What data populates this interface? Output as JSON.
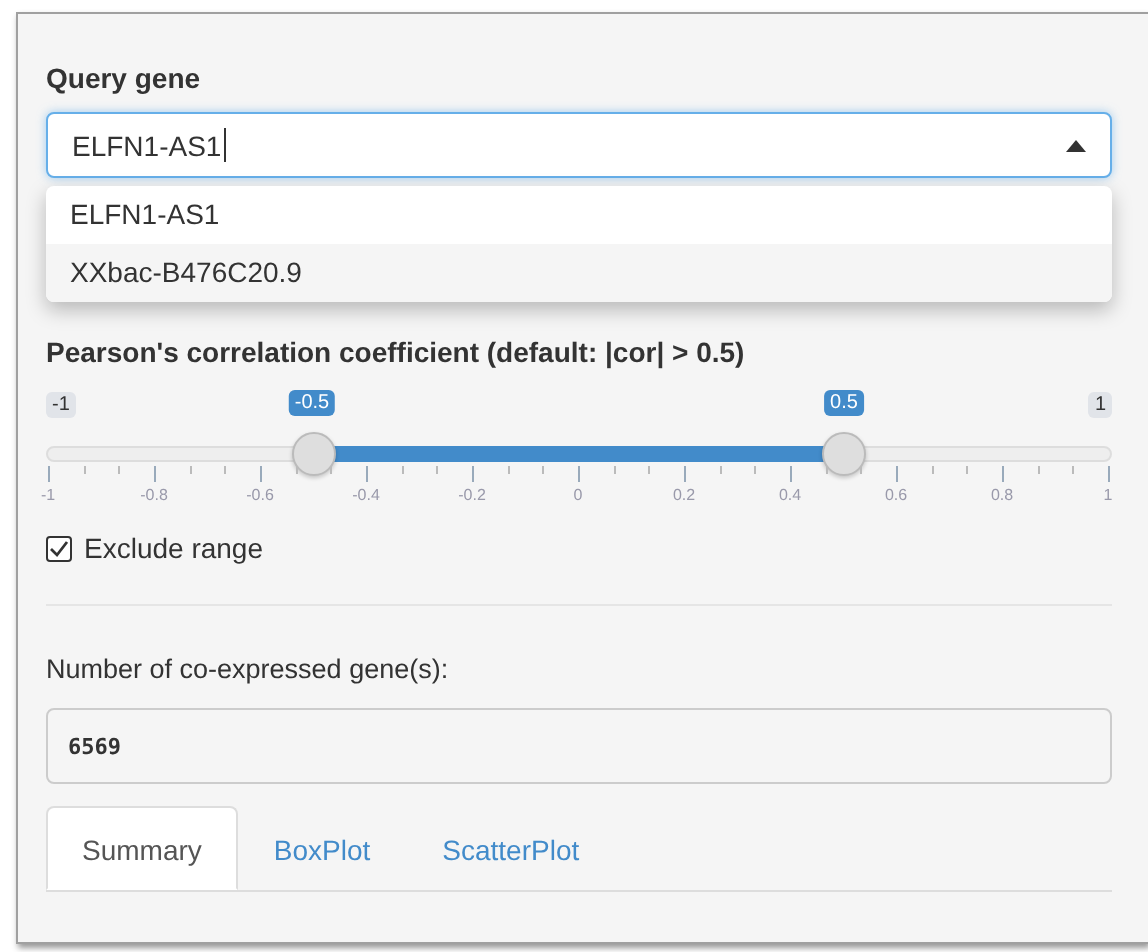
{
  "query": {
    "label": "Query gene",
    "value": "ELFN1-AS1",
    "expanded": true,
    "options": [
      {
        "label": "ELFN1-AS1",
        "highlighted": false
      },
      {
        "label": "XXbac-B476C20.9",
        "highlighted": true
      }
    ]
  },
  "correlation": {
    "label": "Pearson's correlation coefficient (default: |cor| > 0.5)",
    "min_label": "-1",
    "max_label": "1",
    "handles": [
      {
        "label": "-0.5",
        "level": 0.25
      },
      {
        "label": "0.5",
        "level": 0.75
      }
    ],
    "ticks": [
      "-1",
      "-0.8",
      "-0.6",
      "-0.4",
      "-0.2",
      "0",
      "0.2",
      "0.4",
      "0.6",
      "0.8",
      "1"
    ]
  },
  "exclude_range": {
    "label": "Exclude range",
    "checked": true
  },
  "count": {
    "label": "Number of co-expressed gene(s):",
    "value": "6569"
  },
  "tabs": [
    {
      "label": "Summary",
      "selected": true
    },
    {
      "label": "BoxPlot",
      "selected": false
    },
    {
      "label": "ScatterPlot",
      "selected": false
    }
  ]
}
